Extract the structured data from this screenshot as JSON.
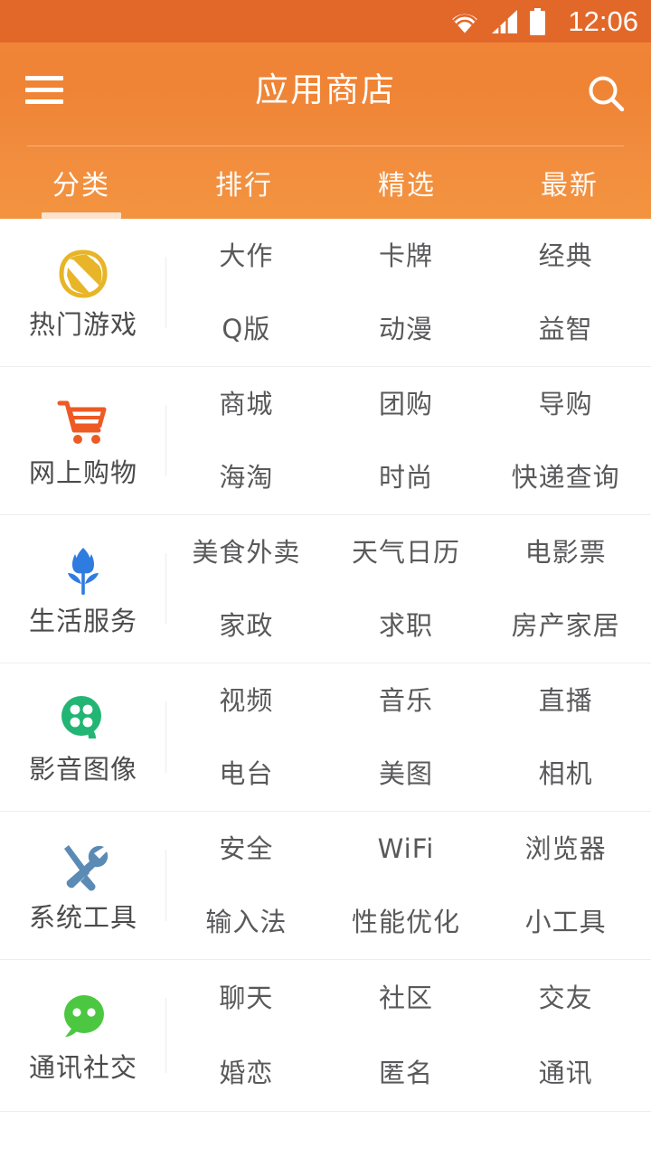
{
  "status_bar": {
    "time": "12:06",
    "icons": [
      "wifi-icon",
      "cellular-signal-icon",
      "battery-icon"
    ]
  },
  "app_bar": {
    "title": "应用商店",
    "menu_icon": "hamburger-menu-icon",
    "search_icon": "search-icon"
  },
  "tabs": [
    {
      "label": "分类",
      "active": true
    },
    {
      "label": "排行",
      "active": false
    },
    {
      "label": "精选",
      "active": false
    },
    {
      "label": "最新",
      "active": false
    }
  ],
  "colors": {
    "status_bar_bg": "#e2682a",
    "app_bar_bg": "#ef8435",
    "tab_bar_bg": "#f28f3e",
    "tab_indicator": "#fae2cd",
    "text_primary": "#4b4b4b",
    "text_sub": "#59595b",
    "divider": "#ededed",
    "icon_games": "#e8b528",
    "icon_shopping": "#ee5a24",
    "icon_life": "#2f7ce0",
    "icon_media": "#22b573",
    "icon_tools": "#5b8ab5",
    "icon_social": "#4cc741"
  },
  "categories": [
    {
      "name": "热门游戏",
      "icon": "shield-leaf-icon",
      "icon_color": "#e8b528",
      "subcategories": [
        "大作",
        "卡牌",
        "经典",
        "Q版",
        "动漫",
        "益智"
      ]
    },
    {
      "name": "网上购物",
      "icon": "shopping-cart-icon",
      "icon_color": "#ee5a24",
      "subcategories": [
        "商城",
        "团购",
        "导购",
        "海淘",
        "时尚",
        "快递查询"
      ]
    },
    {
      "name": "生活服务",
      "icon": "tulip-flower-icon",
      "icon_color": "#2f7ce0",
      "subcategories": [
        "美食外卖",
        "天气日历",
        "电影票",
        "家政",
        "求职",
        "房产家居"
      ]
    },
    {
      "name": "影音图像",
      "icon": "film-reel-icon",
      "icon_color": "#22b573",
      "subcategories": [
        "视频",
        "音乐",
        "直播",
        "电台",
        "美图",
        "相机"
      ]
    },
    {
      "name": "系统工具",
      "icon": "wrench-screwdriver-icon",
      "icon_color": "#5b8ab5",
      "subcategories": [
        "安全",
        "WiFi",
        "浏览器",
        "输入法",
        "性能优化",
        "小工具"
      ]
    },
    {
      "name": "通讯社交",
      "icon": "chat-bubble-icon",
      "icon_color": "#4cc741",
      "subcategories": [
        "聊天",
        "社区",
        "交友",
        "婚恋",
        "匿名",
        "通讯"
      ]
    }
  ]
}
